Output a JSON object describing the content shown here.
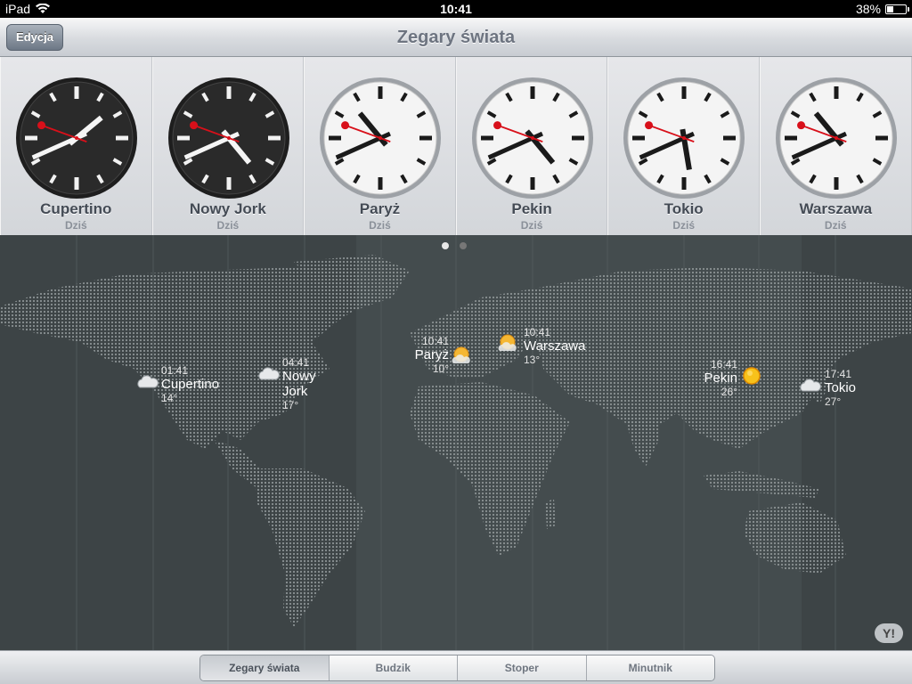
{
  "status": {
    "device": "iPad",
    "time": "10:41",
    "battery": "38%",
    "battery_level": 0.38
  },
  "nav": {
    "title": "Zegary świata",
    "edit_label": "Edycja"
  },
  "clocks": [
    {
      "city": "Cupertino",
      "day": "Dziś",
      "time": "01:41",
      "face": "dark"
    },
    {
      "city": "Nowy Jork",
      "day": "Dziś",
      "time": "04:41",
      "face": "dark"
    },
    {
      "city": "Paryż",
      "day": "Dziś",
      "time": "10:41",
      "face": "light"
    },
    {
      "city": "Pekin",
      "day": "Dziś",
      "time": "16:41",
      "face": "light"
    },
    {
      "city": "Tokio",
      "day": "Dziś",
      "time": "17:41",
      "face": "light"
    },
    {
      "city": "Warszawa",
      "day": "Dziś",
      "time": "10:41",
      "face": "light"
    }
  ],
  "map_pins": [
    {
      "time": "01:41",
      "name": "Cupertino",
      "temp": "14°",
      "weather_icon": "cloud-icon"
    },
    {
      "time": "04:41",
      "name": "Nowy Jork",
      "temp": "17°",
      "weather_icon": "cloud-icon"
    },
    {
      "time": "10:41",
      "name": "Paryż",
      "temp": "10°",
      "weather_icon": "partly-sunny-icon"
    },
    {
      "time": "10:41",
      "name": "Warszawa",
      "temp": "13°",
      "weather_icon": "partly-sunny-icon"
    },
    {
      "time": "16:41",
      "name": "Pekin",
      "temp": "26°",
      "weather_icon": "sun-icon"
    },
    {
      "time": "17:41",
      "name": "Tokio",
      "temp": "27°",
      "weather_icon": "cloud-icon"
    }
  ],
  "yahoo_logo": "Y!",
  "tabs": [
    {
      "label": "Zegary świata",
      "active": true
    },
    {
      "label": "Budzik",
      "active": false
    },
    {
      "label": "Stoper",
      "active": false
    },
    {
      "label": "Minutnik",
      "active": false
    }
  ]
}
